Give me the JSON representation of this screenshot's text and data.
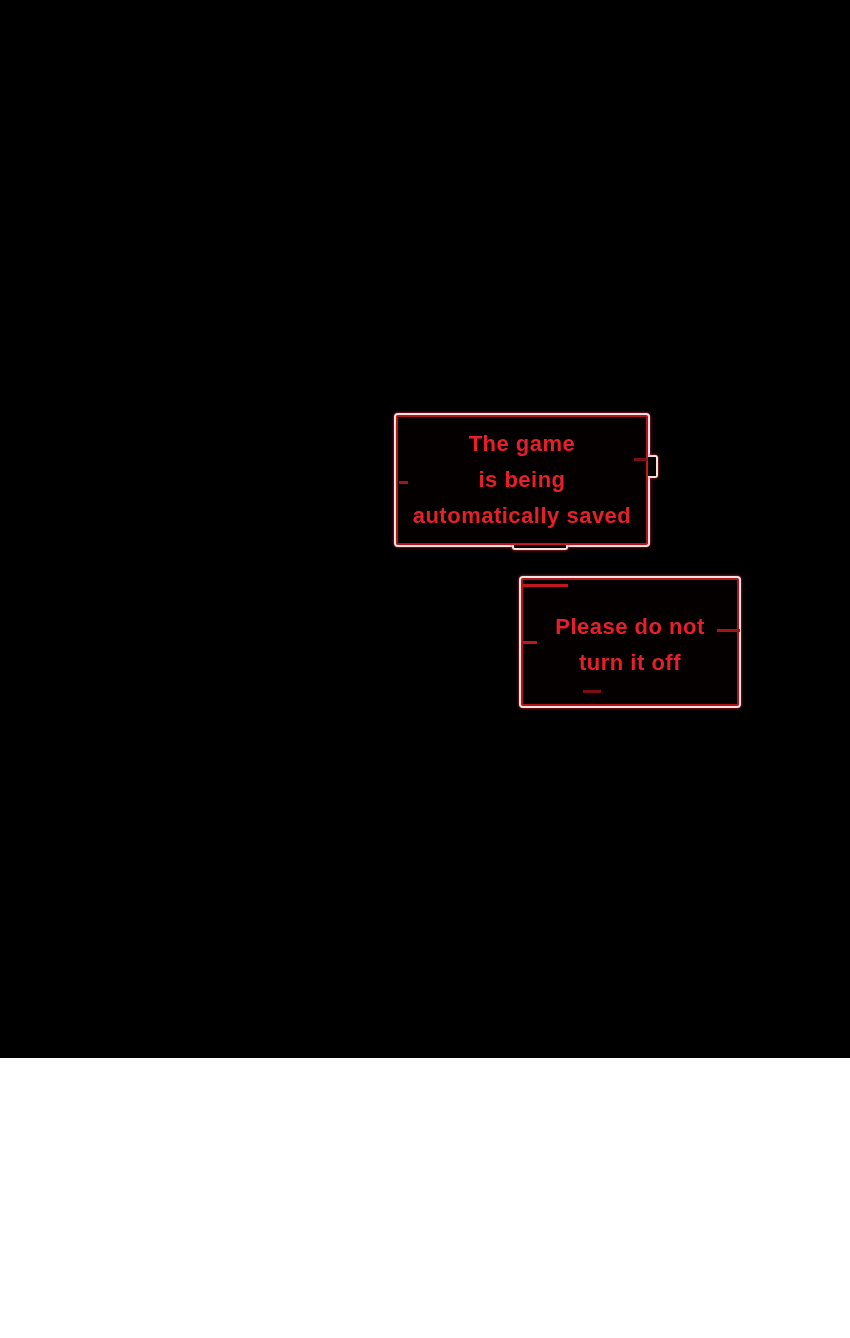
{
  "panel": {
    "captions": [
      {
        "lines": [
          "The game",
          "is being",
          "automatically saved"
        ]
      },
      {
        "lines": [
          "Please do not",
          "turn it off"
        ]
      }
    ]
  }
}
